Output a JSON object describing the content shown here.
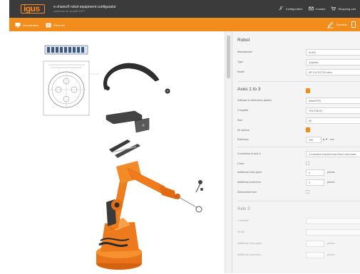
{
  "header": {
    "logo": "igus",
    "app_title": "e-chains® robot equipment configurator",
    "app_subtitle": "solutions for Kuka® KR**",
    "nav": [
      {
        "label": "Configuration",
        "icon": "wrench-icon"
      },
      {
        "label": "Contact",
        "icon": "envelope-icon"
      },
      {
        "label": "Shopping cart",
        "icon": "cart-icon"
      }
    ]
  },
  "toolbar": {
    "left": [
      {
        "label": "Visualization",
        "icon": "monitor-icon"
      },
      {
        "label": "Parts list",
        "icon": "list-icon"
      }
    ],
    "right": [
      {
        "label": "Operator",
        "icon": "pen-icon"
      }
    ]
  },
  "panel": {
    "robot_title": "Robot",
    "robot_fields": [
      {
        "label": "Manufacturer",
        "value": "KUKA"
      },
      {
        "label": "Type",
        "value": "Quantec"
      },
      {
        "label": "Model",
        "value": "KR 210 R2700 extra"
      }
    ],
    "axes_1_3_title": "Axes 1 to 3",
    "axes_1_3_fields": [
      {
        "label": "Software & electronics system",
        "value": "triflex® R3"
      },
      {
        "label": "Complete",
        "value": "TRLF.85.Kit"
      },
      {
        "label": "Size",
        "value": "85"
      },
      {
        "label": "Kit options",
        "value": ""
      },
      {
        "label": "Extension",
        "value": "200"
      },
      {
        "label": "Connection to axis 4",
        "value": "Connection bracket inner fixed robot base"
      },
      {
        "label": "Cover",
        "value": ""
      },
      {
        "label": "Additional hose pipes",
        "value": "0",
        "unit": "pieces"
      },
      {
        "label": "Additional protectors",
        "value": "0",
        "unit": "pieces"
      },
      {
        "label": "Dismounted tube",
        "value": ""
      }
    ],
    "extension_unit": "mm",
    "axis_3_title": "Axis 3",
    "axis_3_fields": [
      {
        "label": "e-channel",
        "value": ""
      },
      {
        "label": "Stroke",
        "value": ""
      },
      {
        "label": "Additional hose pipes",
        "value": "",
        "unit": "pieces"
      },
      {
        "label": "Additional protectors",
        "value": "",
        "unit": "pieces"
      }
    ]
  },
  "colors": {
    "accent": "#f28c1b",
    "header_bg": "#3b3b3b",
    "robot": "#f07a1c"
  }
}
